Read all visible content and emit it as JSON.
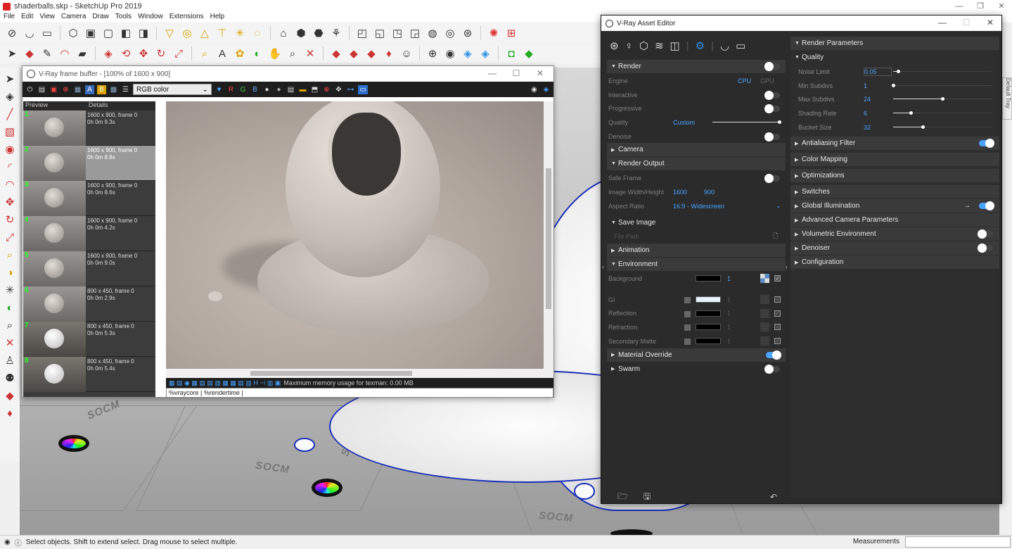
{
  "app": {
    "title": "shaderballs.skp - SketchUp Pro 2019",
    "menus": [
      "File",
      "Edit",
      "View",
      "Camera",
      "Draw",
      "Tools",
      "Window",
      "Extensions",
      "Help"
    ]
  },
  "status": {
    "text": "Select objects. Shift to extend select. Drag mouse to select multiple.",
    "measurements_label": "Measurements"
  },
  "default_tray": "Default Tray",
  "viewport": {
    "labels": [
      "SOCM",
      "SOCM",
      "SOCM",
      "SOCM",
      "chUp"
    ]
  },
  "frame_buffer": {
    "title": "V-Ray frame buffer - [100% of 1600 x 900]",
    "channel": "RGB color",
    "history_headers": {
      "preview": "Preview",
      "details": "Details"
    },
    "history": [
      {
        "num": "1",
        "details": "1600 x 900, frame 0",
        "time": "0h 0m 9.3s"
      },
      {
        "num": "2",
        "details": "1600 x 900, frame 0",
        "time": "0h 0m 8.8s",
        "selected": true
      },
      {
        "num": "3",
        "details": "1600 x 900, frame 0",
        "time": "0h 0m 8.6s"
      },
      {
        "num": "4",
        "details": "1600 x 900, frame 0",
        "time": "0h 0m 4.2s"
      },
      {
        "num": "5",
        "details": "1600 x 900, frame 0",
        "time": "0h 0m 9.0s"
      },
      {
        "num": "6",
        "details": "800 x 450, frame 0",
        "time": "0h 0m 2.9s"
      },
      {
        "num": "7",
        "details": "800 x 450, frame 0",
        "time": "0h 0m 5.3s"
      },
      {
        "num": "8",
        "details": "800 x 450, frame 0",
        "time": "0h 0m 5.4s"
      }
    ],
    "status_text": "Maximum memory usage for texman: 0.00 MB",
    "command_line": "%vraycore | %rendertime |",
    "tool_letters": {
      "r": "R",
      "g": "G",
      "b": "B",
      "a": "A",
      "b2": "B"
    }
  },
  "asset_editor": {
    "title": "V-Ray Asset Editor",
    "sections": {
      "render": "Render",
      "camera": "Camera",
      "render_output": "Render Output",
      "save_image": "Save Image",
      "animation": "Animation",
      "environment": "Environment",
      "material_override": "Material Override",
      "swarm": "Swarm"
    },
    "render": {
      "engine_label": "Engine",
      "engine_cpu": "CPU",
      "engine_gpu": "GPU",
      "interactive_label": "Interactive",
      "interactive": false,
      "progressive_label": "Progressive",
      "progressive": false,
      "quality_label": "Quality",
      "quality_value": "Custom",
      "denoise_label": "Denoise",
      "denoise": false
    },
    "render_output": {
      "safe_frame_label": "Safe Frame",
      "safe_frame": false,
      "size_label": "Image Width/Height",
      "width": "1600",
      "height": "900",
      "aspect_label": "Aspect Ratio",
      "aspect_value": "16:9 - Widescreen",
      "file_path_label": "File Path"
    },
    "environment": {
      "background_label": "Background",
      "background_value": "1",
      "gi_label": "GI",
      "gi_value": "1",
      "reflection_label": "Reflection",
      "reflection_value": "1",
      "refraction_label": "Refraction",
      "refraction_value": "1",
      "secondary_label": "Secondary Matte",
      "secondary_value": "1"
    },
    "right": {
      "render_parameters": "Render Parameters",
      "quality": "Quality",
      "params": [
        {
          "label": "Noise Limit",
          "value": "0.05",
          "slider": 0.05
        },
        {
          "label": "Min Subdivs",
          "value": "1",
          "slider": 0.0
        },
        {
          "label": "Max Subdivs",
          "value": "24",
          "slider": 0.5
        },
        {
          "label": "Shading Rate",
          "value": "6",
          "slider": 0.18
        },
        {
          "label": "Bucket Size",
          "value": "32",
          "slider": 0.3
        }
      ],
      "groups": [
        {
          "label": "Antialiasing Filter",
          "toggle": "on"
        },
        {
          "label": "Color Mapping"
        },
        {
          "label": "Optimizations"
        },
        {
          "label": "Switches"
        },
        {
          "label": "Global Illumination",
          "toggle": "on"
        },
        {
          "label": "Advanced Camera Parameters"
        },
        {
          "label": "Volumetric Environment",
          "toggle": "off"
        },
        {
          "label": "Denoiser",
          "toggle": "off"
        },
        {
          "label": "Configuration"
        }
      ]
    }
  }
}
